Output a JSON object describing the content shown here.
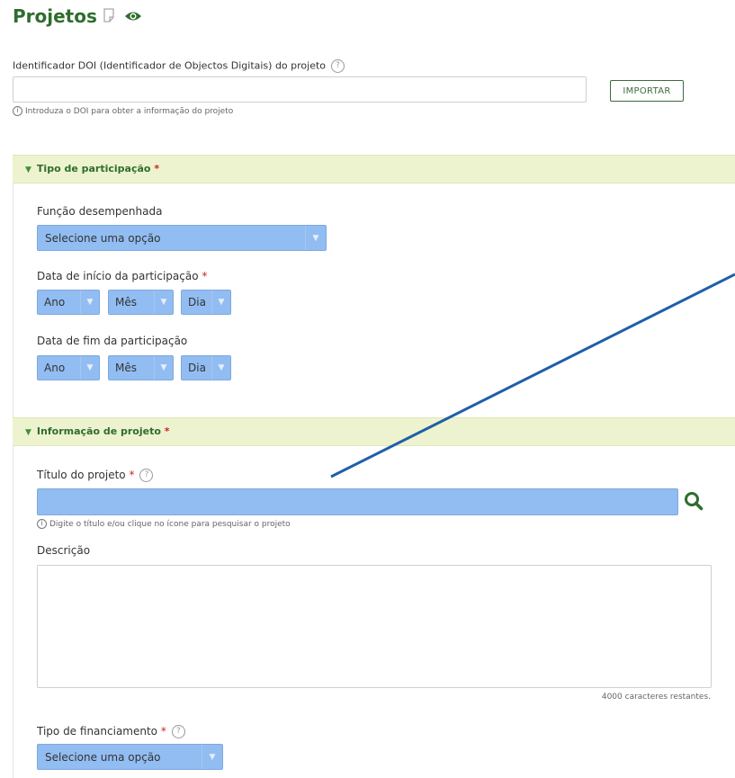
{
  "header": {
    "title": "Projetos"
  },
  "doi": {
    "label": "Identificador DOI (Identificador de Objectos Digitais) do projeto",
    "value": "",
    "hint": "Introduza o DOI para obter a informação do projeto",
    "import_label": "IMPORTAR"
  },
  "participation": {
    "section_title": "Tipo de participação",
    "required_mark": "*",
    "role_label": "Função desempenhada",
    "role_value": "Selecione uma opção",
    "start_label": "Data de início da participação",
    "end_label": "Data de fim da participação",
    "year": "Ano",
    "month": "Mês",
    "day": "Dia"
  },
  "project": {
    "section_title": "Informação de projeto",
    "required_mark": "*",
    "title_label": "Título do projeto",
    "title_value": "",
    "title_hint": "Digite o título e/ou clique no ícone para pesquisar o projeto",
    "description_label": "Descrição",
    "description_value": "",
    "remaining": "4000 caracteres restantes.",
    "funding_label": "Tipo de financiamento",
    "funding_value": "Selecione uma opção"
  },
  "colors": {
    "accent": "#2e6d2e",
    "select_bg": "#92bdf2",
    "section_bg": "#eef3cf",
    "arrow": "#1f5fa8"
  },
  "icons": [
    "note-icon",
    "eye-icon",
    "help-icon",
    "info-icon",
    "caret-down-icon",
    "search-icon"
  ]
}
